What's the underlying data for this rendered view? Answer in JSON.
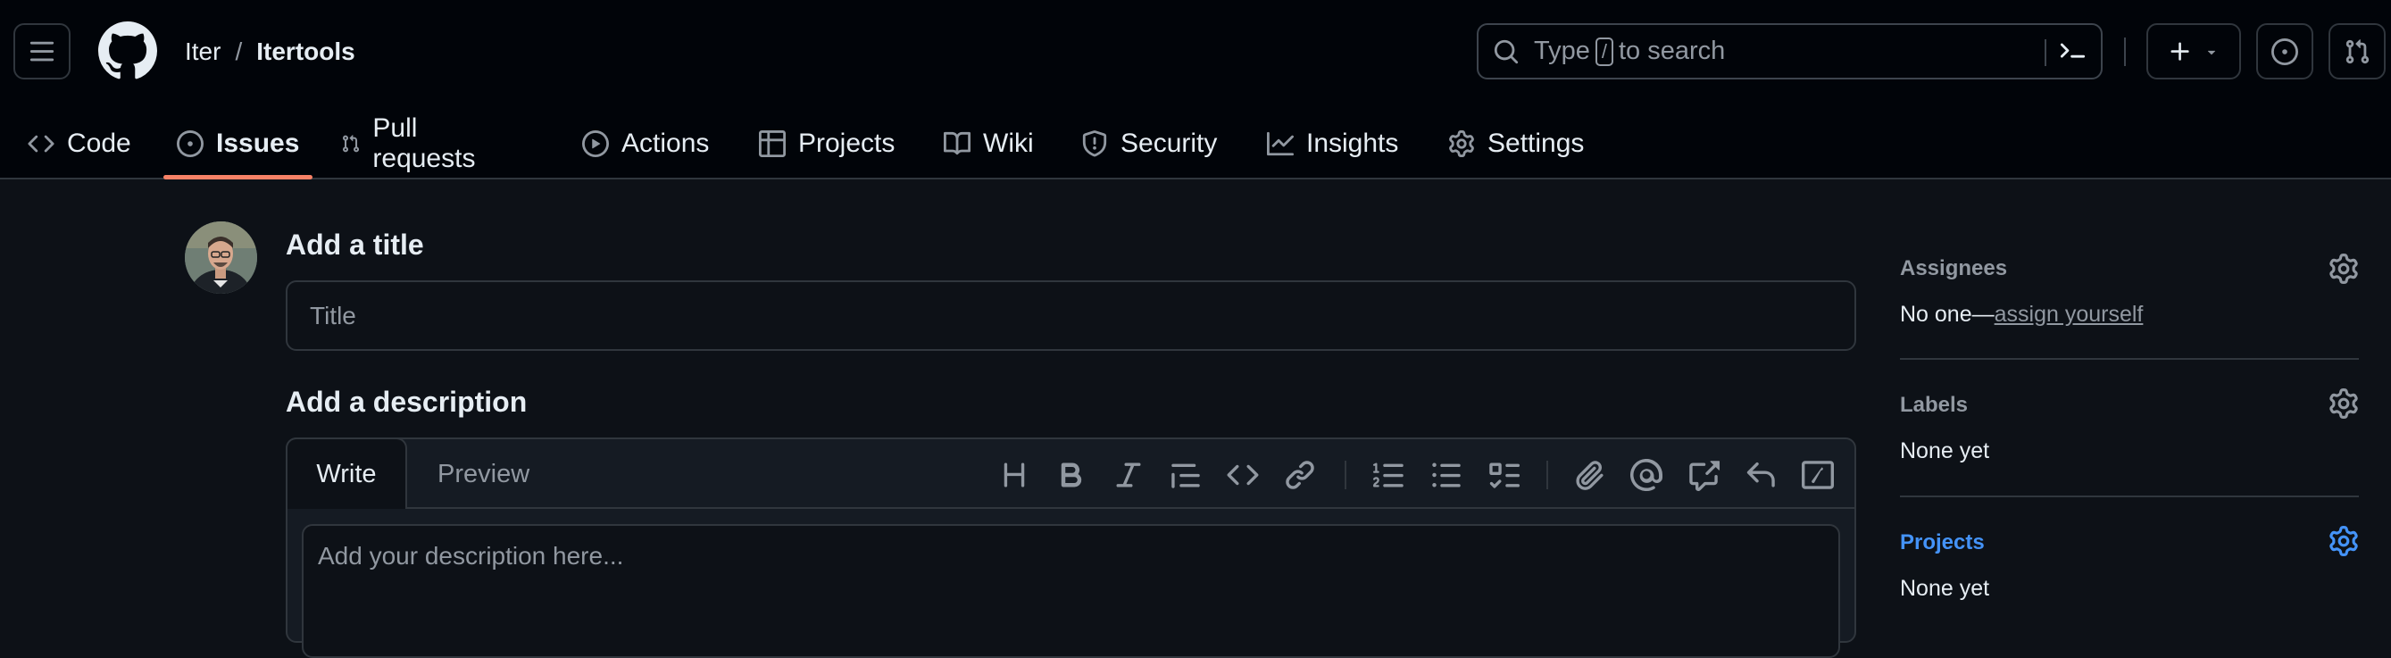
{
  "repo": {
    "owner": "Iter",
    "separator": "/",
    "name": "Itertools"
  },
  "search": {
    "prefix": "Type",
    "key": "/",
    "suffix": "to search"
  },
  "icons": [
    "menu-icon",
    "github-logo-icon",
    "search-icon",
    "terminal-icon",
    "plus-icon",
    "chevron-down-icon",
    "issue-opened-icon",
    "pull-request-icon",
    "code-icon",
    "play-icon",
    "table-icon",
    "book-icon",
    "shield-icon",
    "graph-icon",
    "gear-icon"
  ],
  "tabs": [
    {
      "label": "Code"
    },
    {
      "label": "Issues"
    },
    {
      "label": "Pull requests"
    },
    {
      "label": "Actions"
    },
    {
      "label": "Projects"
    },
    {
      "label": "Wiki"
    },
    {
      "label": "Security"
    },
    {
      "label": "Insights"
    },
    {
      "label": "Settings"
    }
  ],
  "form": {
    "title_heading": "Add a title",
    "title_placeholder": "Title",
    "description_heading": "Add a description",
    "write_tab": "Write",
    "preview_tab": "Preview",
    "description_placeholder": "Add your description here..."
  },
  "sidebar": {
    "assignees": {
      "heading": "Assignees",
      "value": "No one—",
      "link": "assign yourself"
    },
    "labels": {
      "heading": "Labels",
      "value": "None yet"
    },
    "projects": {
      "heading": "Projects",
      "value": "None yet"
    }
  },
  "colors": {
    "accent_underline": "#f78166",
    "link_blue": "#4493f8",
    "background": "#0d1117",
    "header_bg": "#010409"
  }
}
